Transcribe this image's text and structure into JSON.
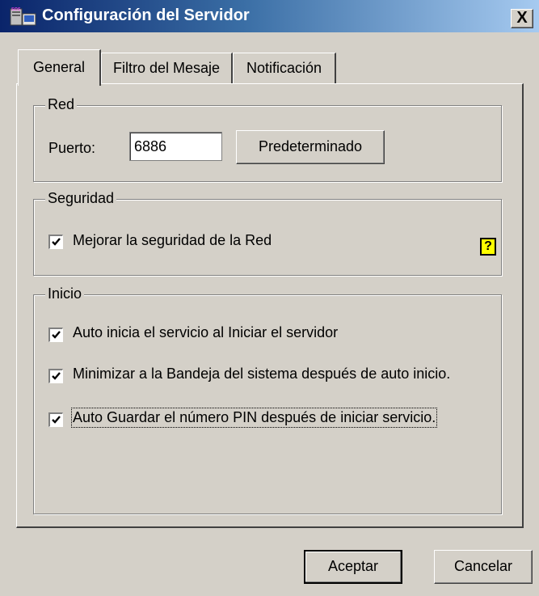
{
  "window": {
    "title": "Configuración del Servidor",
    "close_glyph": "X",
    "title_icon": "server-app-icon"
  },
  "tabs": [
    {
      "label": "General",
      "active": true
    },
    {
      "label": "Filtro del Mesaje",
      "active": false
    },
    {
      "label": "Notificación",
      "active": false
    }
  ],
  "red": {
    "title": "Red",
    "port_label": "Puerto:",
    "port_value": "6886",
    "default_button": "Predeterminado"
  },
  "seguridad": {
    "title": "Seguridad",
    "improve_label": "Mejorar la seguridad de la Red",
    "improve_checked": true,
    "help_icon": "help-question-icon",
    "help_glyph": "?"
  },
  "inicio": {
    "title": "Inicio",
    "options": [
      {
        "label": "Auto inicia el servicio al Iniciar el servidor",
        "checked": true
      },
      {
        "label": "Minimizar a la Bandeja del sistema después de auto inicio.",
        "checked": true
      },
      {
        "label": "Auto Guardar el número PIN después de iniciar servicio.",
        "checked": true
      }
    ]
  },
  "footer": {
    "ok": "Aceptar",
    "cancel": "Cancelar"
  },
  "colors": {
    "face": "#d4d0c8",
    "title_start": "#0a246a",
    "title_end": "#a6caf0",
    "help_bg": "#ffff00"
  }
}
